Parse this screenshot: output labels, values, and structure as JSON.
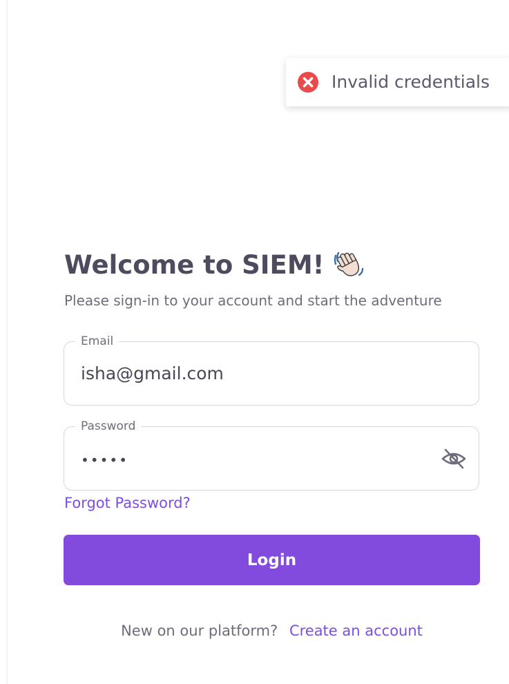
{
  "toast": {
    "icon": "error-circle-icon",
    "message": "Invalid credentials",
    "color": "#ea4a4a"
  },
  "login": {
    "title": "Welcome to SIEM!",
    "title_icon": "waving-hand-icon",
    "subtitle": "Please sign-in to your account and start the adventure",
    "email_label": "Email",
    "email_value": "isha@gmail.com",
    "password_label": "Password",
    "password_value": "•••••",
    "password_toggle_icon": "eye-off-icon",
    "forgot_password": "Forgot Password?",
    "submit_label": "Login",
    "signup_prompt": "New on our platform?",
    "signup_link": "Create an account"
  },
  "colors": {
    "primary": "#824bdd",
    "link": "#7b4ee6",
    "error": "#ea4a4a",
    "text": "#4f4a5e"
  }
}
